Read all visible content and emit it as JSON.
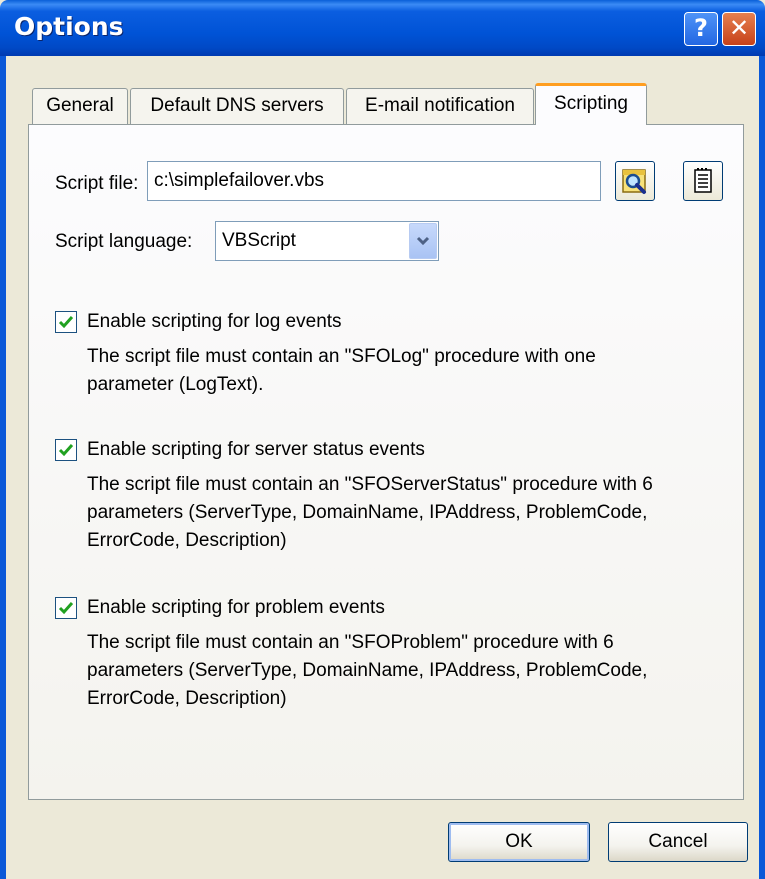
{
  "window": {
    "title": "Options",
    "help_label": "?",
    "close_label": "✕"
  },
  "tabs": [
    {
      "label": "General",
      "active": false
    },
    {
      "label": "Default DNS servers",
      "active": false
    },
    {
      "label": "E-mail notification",
      "active": false
    },
    {
      "label": "Scripting",
      "active": true
    }
  ],
  "scripting": {
    "script_file_label": "Script file:",
    "script_file_value": "c:\\simplefailover.vbs",
    "script_language_label": "Script language:",
    "script_language_value": "VBScript",
    "options": [
      {
        "checked": true,
        "label": "Enable scripting for log events",
        "description": [
          "The script file must contain an \"SFOLog\" procedure with one",
          "parameter (LogText)."
        ]
      },
      {
        "checked": true,
        "label": "Enable scripting for server status events",
        "description": [
          "The script file must contain an \"SFOServerStatus\" procedure with 6",
          "parameters (ServerType, DomainName, IPAddress, ProblemCode,",
          "ErrorCode, Description)"
        ]
      },
      {
        "checked": true,
        "label": "Enable scripting for problem events",
        "description": [
          "The script file must contain an \"SFOProblem\" procedure with 6",
          "parameters (ServerType, DomainName, IPAddress, ProblemCode,",
          "ErrorCode, Description)"
        ]
      }
    ]
  },
  "buttons": {
    "ok": "OK",
    "cancel": "Cancel"
  }
}
